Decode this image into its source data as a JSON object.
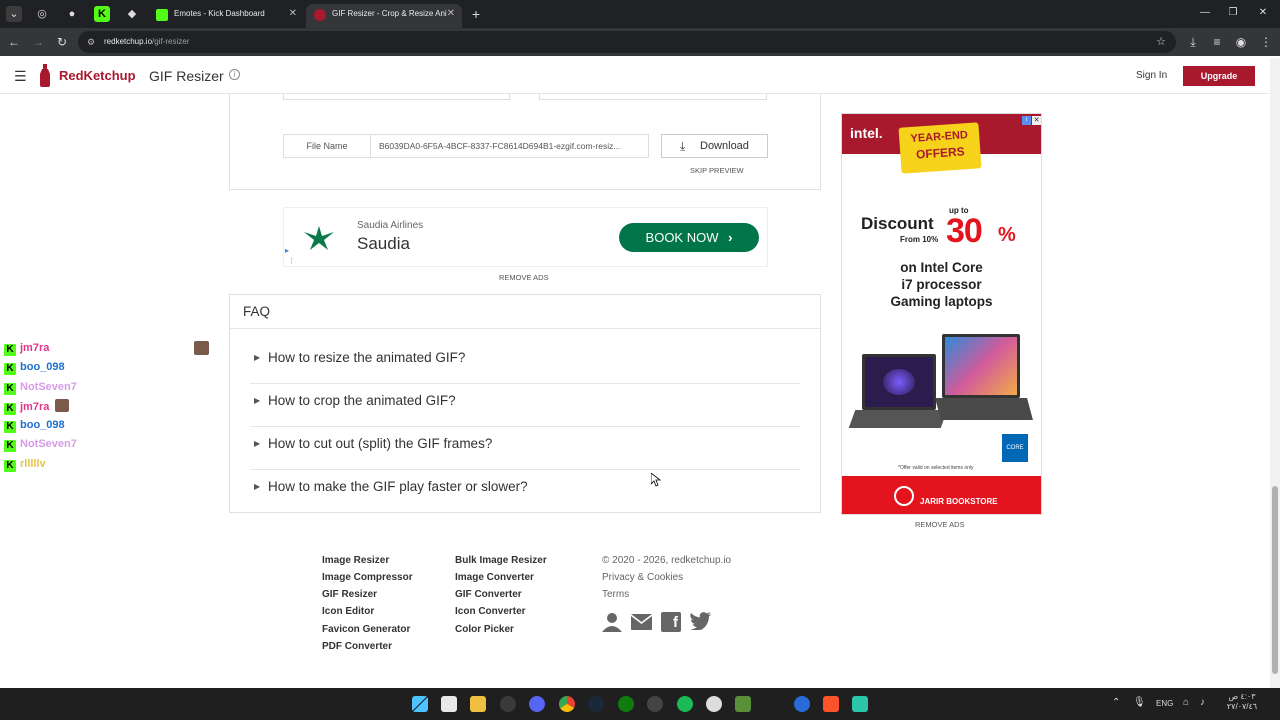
{
  "browser": {
    "tabs": [
      {
        "title": "Emotes - Kick Dashboard",
        "favicon": "kick-icon",
        "active": false
      },
      {
        "title": "GIF Resizer - Crop & Resize Ani",
        "favicon": "redketchup-icon",
        "active": true
      }
    ],
    "url_host": "redketchup.io",
    "url_path": "/gif-resizer"
  },
  "header": {
    "brand": "RedKetchup",
    "page_title": "GIF Resizer",
    "sign_in": "Sign In",
    "upgrade": "Upgrade"
  },
  "result": {
    "file_name_label": "File Name",
    "file_name_value": "B6039DA0-6F5A-4BCF-8337-FC8614D694B1-ezgif.com-resiz...",
    "download_label": "Download",
    "skip_preview": "SKIP PREVIEW"
  },
  "ad_banner": {
    "advertiser": "Saudia Airlines",
    "brand": "Saudia",
    "cta": "BOOK NOW",
    "remove_ads": "REMOVE ADS"
  },
  "faq": {
    "title": "FAQ",
    "items": [
      "How to resize the animated GIF?",
      "How to crop the animated GIF?",
      "How to cut out (split) the GIF frames?",
      "How to make the GIF play faster or slower?"
    ]
  },
  "side_ad": {
    "brand": "intel.",
    "badge_line1": "YEAR-END",
    "badge_line2": "OFFERS",
    "discount_label": "Discount",
    "up_to": "up to",
    "from": "From 10%",
    "percent": "30",
    "percent_sign": "%",
    "line1": "on Intel Core",
    "line2": "i7 processor",
    "line3": "Gaming laptops",
    "fine_print": "*Offer valid on selected items only",
    "store": "JARIR BOOKSTORE",
    "core_badge": "CORE",
    "remove_ads": "REMOVE ADS"
  },
  "chat": [
    {
      "user": "jm7ra",
      "color": "#e0358a"
    },
    {
      "user": "boo_098",
      "color": "#1e6fd0"
    },
    {
      "user": "NotSeven7",
      "color": "#d89be8"
    },
    {
      "user": "jm7ra",
      "color": "#e0358a"
    },
    {
      "user": "boo_098",
      "color": "#1e6fd0"
    },
    {
      "user": "NotSeven7",
      "color": "#d89be8"
    },
    {
      "user": "rlllllv",
      "color": "#e6c44a"
    }
  ],
  "footer": {
    "col1": [
      "Image Resizer",
      "Image Compressor",
      "GIF Resizer",
      "Icon Editor",
      "Favicon Generator",
      "PDF Converter"
    ],
    "col2": [
      "Bulk Image Resizer",
      "Image Converter",
      "GIF Converter",
      "Icon Converter",
      "Color Picker"
    ],
    "copyright": "© 2020 - 2026, redketchup.io",
    "privacy": "Privacy & Cookies",
    "terms": "Terms"
  },
  "taskbar": {
    "lang": "ENG",
    "time": "٤:٠٣ ص",
    "date": "٢٧/٠٧/٤٦"
  },
  "colors": {
    "brand_red": "#a8192e",
    "book_green": "#00754a",
    "intel_blue": "#0068b5"
  }
}
